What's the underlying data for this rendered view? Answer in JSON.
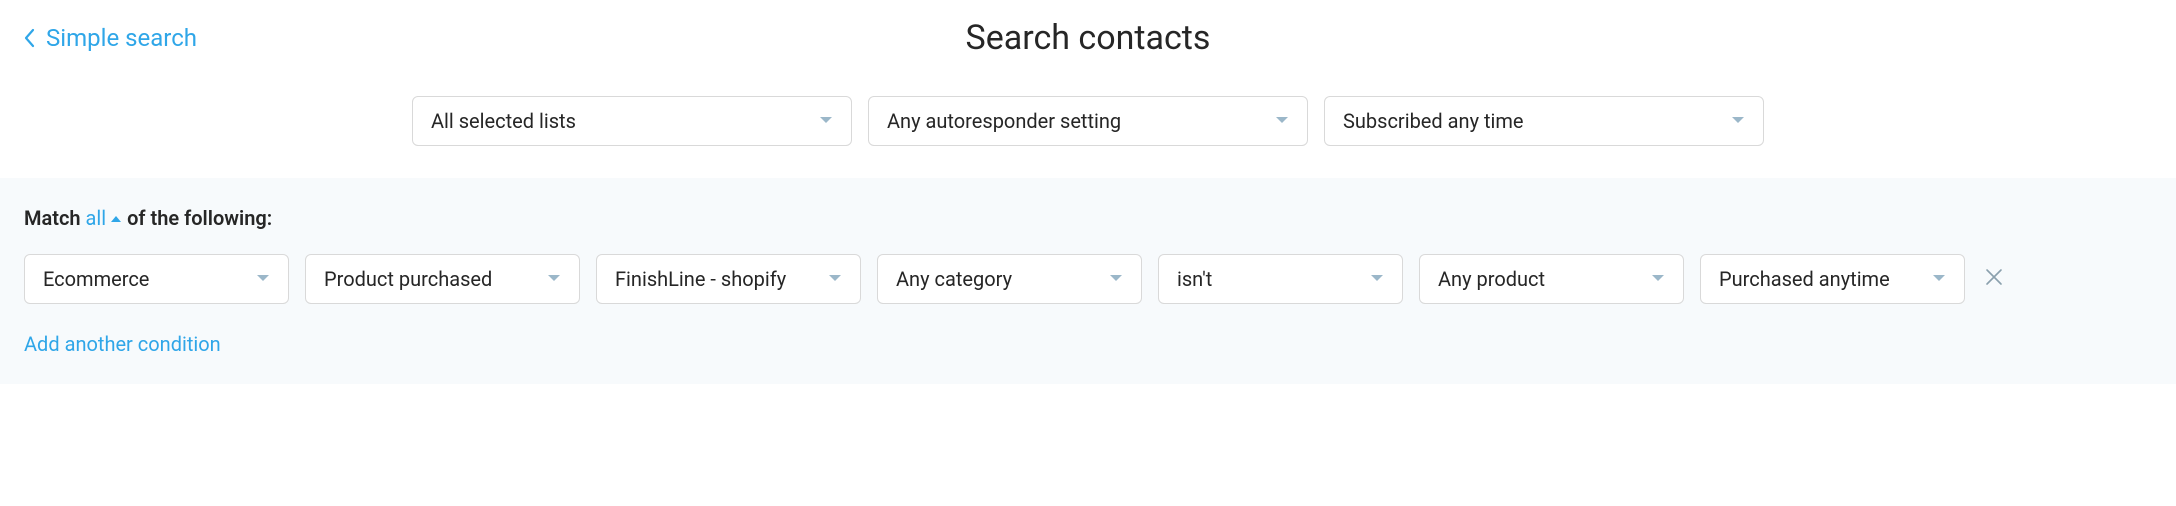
{
  "header": {
    "back_label": "Simple search",
    "title": "Search contacts"
  },
  "filters": {
    "lists": "All selected lists",
    "autoresponder": "Any autoresponder setting",
    "subscribed": "Subscribed any time"
  },
  "match": {
    "prefix": "Match",
    "mode": "all",
    "suffix": "of the following:"
  },
  "conditions": [
    {
      "field": "Ecommerce",
      "event": "Product purchased",
      "store": "FinishLine - shopify",
      "category": "Any category",
      "operator": "isn't",
      "product": "Any product",
      "time": "Purchased anytime"
    }
  ],
  "actions": {
    "add_condition": "Add another condition"
  }
}
